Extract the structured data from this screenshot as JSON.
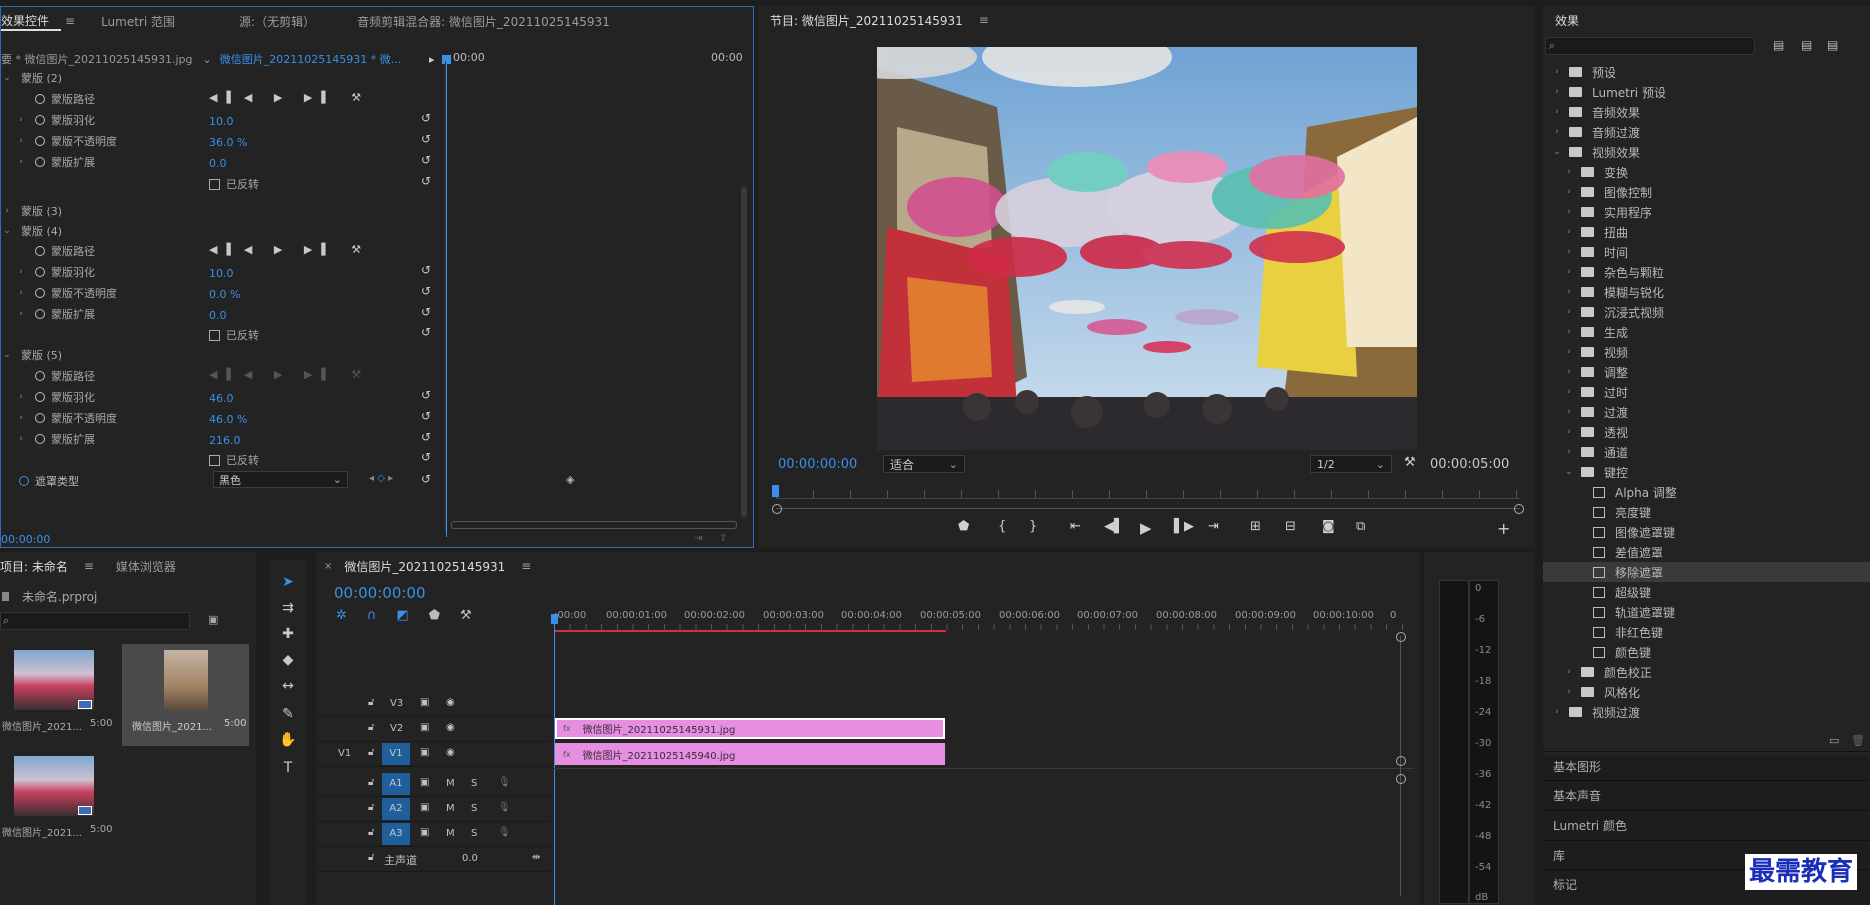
{
  "effect_controls": {
    "tabs": [
      "效果控件",
      "Lumetri 范围",
      "源:（无剪辑）",
      "音频剪辑混合器: 微信图片_20211025145931"
    ],
    "source_label": "要 * 微信图片_20211025145931.jpg",
    "clip_label": "微信图片_20211025145931 * 微...",
    "time_start": "00:00",
    "time_end": "00:00",
    "current_time": "00:00:00",
    "masks": [
      {
        "name": "蒙版 (2)",
        "path": "蒙版路径",
        "feather_label": "蒙版羽化",
        "feather": "10.0",
        "opacity_label": "蒙版不透明度",
        "opacity": "36.0 %",
        "expand_label": "蒙版扩展",
        "expand": "0.0",
        "inverted": "已反转"
      },
      {
        "name": "蒙版 (3)"
      },
      {
        "name": "蒙版 (4)",
        "path": "蒙版路径",
        "feather_label": "蒙版羽化",
        "feather": "10.0",
        "opacity_label": "蒙版不透明度",
        "opacity": "0.0 %",
        "expand_label": "蒙版扩展",
        "expand": "0.0",
        "inverted": "已反转"
      },
      {
        "name": "蒙版 (5)",
        "path": "蒙版路径",
        "feather_label": "蒙版羽化",
        "feather": "46.0",
        "opacity_label": "蒙版不透明度",
        "opacity": "46.0 %",
        "expand_label": "蒙版扩展",
        "expand": "216.0",
        "inverted": "已反转"
      }
    ],
    "matte_type_label": "遮罩类型",
    "matte_type_value": "黑色"
  },
  "program": {
    "title": "节目: 微信图片_20211025145931",
    "timecode": "00:00:00:00",
    "fit": "适合",
    "resolution": "1/2",
    "duration": "00:00:05:00"
  },
  "project": {
    "tabs": [
      "项目: 未命名",
      "媒体浏览器"
    ],
    "file": "未命名.prproj",
    "items": [
      {
        "name": "微信图片_2021...",
        "duration": "5:00"
      },
      {
        "name": "微信图片_2021...",
        "duration": "5:00"
      },
      {
        "name": "微信图片_2021...",
        "duration": "5:00"
      }
    ]
  },
  "timeline": {
    "title": "微信图片_20211025145931",
    "timecode": "00:00:00:00",
    "ruler": [
      ":00:00",
      "00:00:01:00",
      "00:00:02:00",
      "00:00:03:00",
      "00:00:04:00",
      "00:00:05:00",
      "00:00:06:00",
      "00:00:07:00",
      "00:00:08:00",
      "00:00:09:00",
      "00:00:10:00",
      "0"
    ],
    "tracks": {
      "v3": "V3",
      "v2": "V2",
      "v1": "V1",
      "v1_src": "V1",
      "a1": "A1",
      "a2": "A2",
      "a3": "A3",
      "m": "M",
      "s": "S",
      "master": "主声道",
      "master_value": "0.0"
    },
    "clips": [
      {
        "name": "微信图片_20211025145931.jpg"
      },
      {
        "name": "微信图片_20211025145940.jpg"
      }
    ]
  },
  "meter": {
    "scale": [
      "0",
      "-6",
      "-12",
      "-18",
      "-24",
      "-30",
      "-36",
      "-42",
      "-48",
      "-54",
      "dB"
    ]
  },
  "effects": {
    "title": "效果",
    "items": [
      {
        "label": "预设",
        "level": 0,
        "icon": "folder"
      },
      {
        "label": "Lumetri 预设",
        "level": 0,
        "icon": "folder"
      },
      {
        "label": "音频效果",
        "level": 0,
        "icon": "folder"
      },
      {
        "label": "音频过渡",
        "level": 0,
        "icon": "folder"
      },
      {
        "label": "视频效果",
        "level": 0,
        "icon": "folder",
        "open": true
      },
      {
        "label": "变换",
        "level": 1,
        "icon": "folder"
      },
      {
        "label": "图像控制",
        "level": 1,
        "icon": "folder"
      },
      {
        "label": "实用程序",
        "level": 1,
        "icon": "folder"
      },
      {
        "label": "扭曲",
        "level": 1,
        "icon": "folder"
      },
      {
        "label": "时间",
        "level": 1,
        "icon": "folder"
      },
      {
        "label": "杂色与颗粒",
        "level": 1,
        "icon": "folder"
      },
      {
        "label": "模糊与锐化",
        "level": 1,
        "icon": "folder"
      },
      {
        "label": "沉浸式视频",
        "level": 1,
        "icon": "folder"
      },
      {
        "label": "生成",
        "level": 1,
        "icon": "folder"
      },
      {
        "label": "视频",
        "level": 1,
        "icon": "folder"
      },
      {
        "label": "调整",
        "level": 1,
        "icon": "folder"
      },
      {
        "label": "过时",
        "level": 1,
        "icon": "folder"
      },
      {
        "label": "过渡",
        "level": 1,
        "icon": "folder"
      },
      {
        "label": "透视",
        "level": 1,
        "icon": "folder"
      },
      {
        "label": "通道",
        "level": 1,
        "icon": "folder"
      },
      {
        "label": "键控",
        "level": 1,
        "icon": "folder",
        "open": true
      },
      {
        "label": "Alpha 调整",
        "level": 2,
        "icon": "fx"
      },
      {
        "label": "亮度键",
        "level": 2,
        "icon": "fx"
      },
      {
        "label": "图像遮罩键",
        "level": 2,
        "icon": "fx"
      },
      {
        "label": "差值遮罩",
        "level": 2,
        "icon": "fx"
      },
      {
        "label": "移除遮罩",
        "level": 2,
        "icon": "fx",
        "selected": true
      },
      {
        "label": "超级键",
        "level": 2,
        "icon": "fx"
      },
      {
        "label": "轨道遮罩键",
        "level": 2,
        "icon": "fx"
      },
      {
        "label": "非红色键",
        "level": 2,
        "icon": "fx"
      },
      {
        "label": "颜色键",
        "level": 2,
        "icon": "fx"
      },
      {
        "label": "颜色校正",
        "level": 1,
        "icon": "folder"
      },
      {
        "label": "风格化",
        "level": 1,
        "icon": "folder"
      },
      {
        "label": "视频过渡",
        "level": 0,
        "icon": "folder"
      }
    ],
    "bottom_panels": [
      "基本图形",
      "基本声音",
      "Lumetri 颜色",
      "库",
      "标记"
    ]
  },
  "watermark": "最需教育"
}
